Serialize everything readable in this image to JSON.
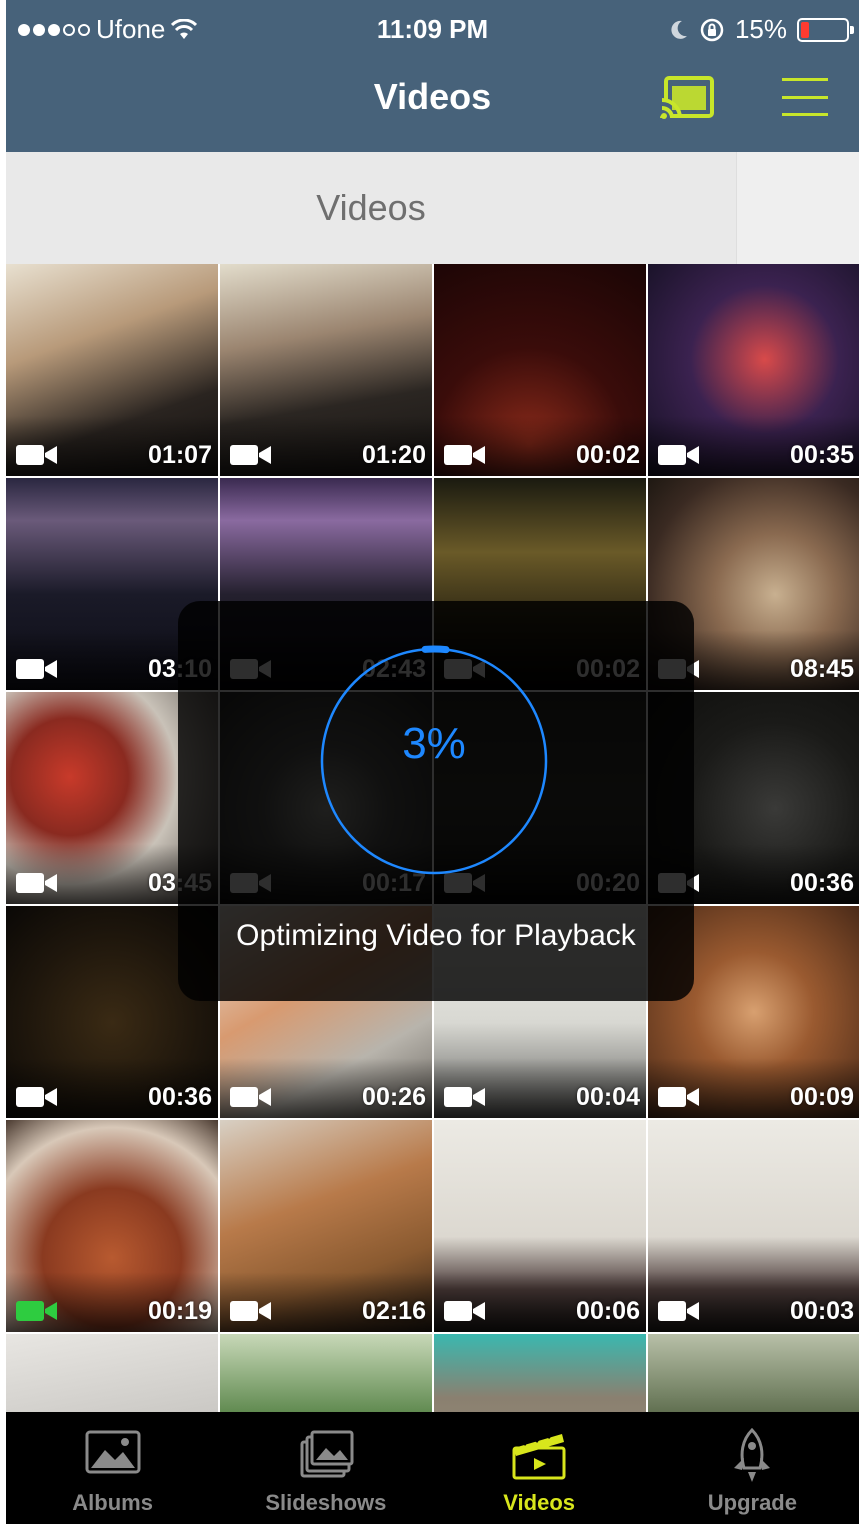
{
  "status_bar": {
    "carrier": "Ufone",
    "time": "11:09 PM",
    "battery": "15%"
  },
  "header": {
    "title": "Videos",
    "cast_icon": "cast-icon",
    "menu_icon": "hamburger-menu-icon",
    "accent_color": "#c8e62a"
  },
  "segment": {
    "label": "Videos"
  },
  "videos": [
    {
      "duration": "01:07"
    },
    {
      "duration": "01:20"
    },
    {
      "duration": "00:02"
    },
    {
      "duration": "00:35"
    },
    {
      "duration": "03:10"
    },
    {
      "duration": "02:43"
    },
    {
      "duration": "00:02"
    },
    {
      "duration": "08:45"
    },
    {
      "duration": "03:45"
    },
    {
      "duration": "00:17"
    },
    {
      "duration": "00:20"
    },
    {
      "duration": "00:36"
    },
    {
      "duration": "00:36"
    },
    {
      "duration": "00:26"
    },
    {
      "duration": "00:04"
    },
    {
      "duration": "00:09"
    },
    {
      "duration": "00:19"
    },
    {
      "duration": "02:16"
    },
    {
      "duration": "00:06"
    },
    {
      "duration": "00:03"
    },
    {
      "duration": ""
    },
    {
      "duration": ""
    },
    {
      "duration": ""
    },
    {
      "duration": ""
    }
  ],
  "overlay": {
    "percent": "3%",
    "progress": 0.03,
    "message": "Optimizing Video for Playback",
    "color": "#1e88ff"
  },
  "tabbar": {
    "tabs": [
      {
        "label": "Albums",
        "icon": "photo-icon"
      },
      {
        "label": "Slideshows",
        "icon": "slideshow-icon"
      },
      {
        "label": "Videos",
        "icon": "clapperboard-icon"
      },
      {
        "label": "Upgrade",
        "icon": "rocket-icon"
      }
    ],
    "active_index": 2,
    "active_color": "#d8e61c"
  }
}
